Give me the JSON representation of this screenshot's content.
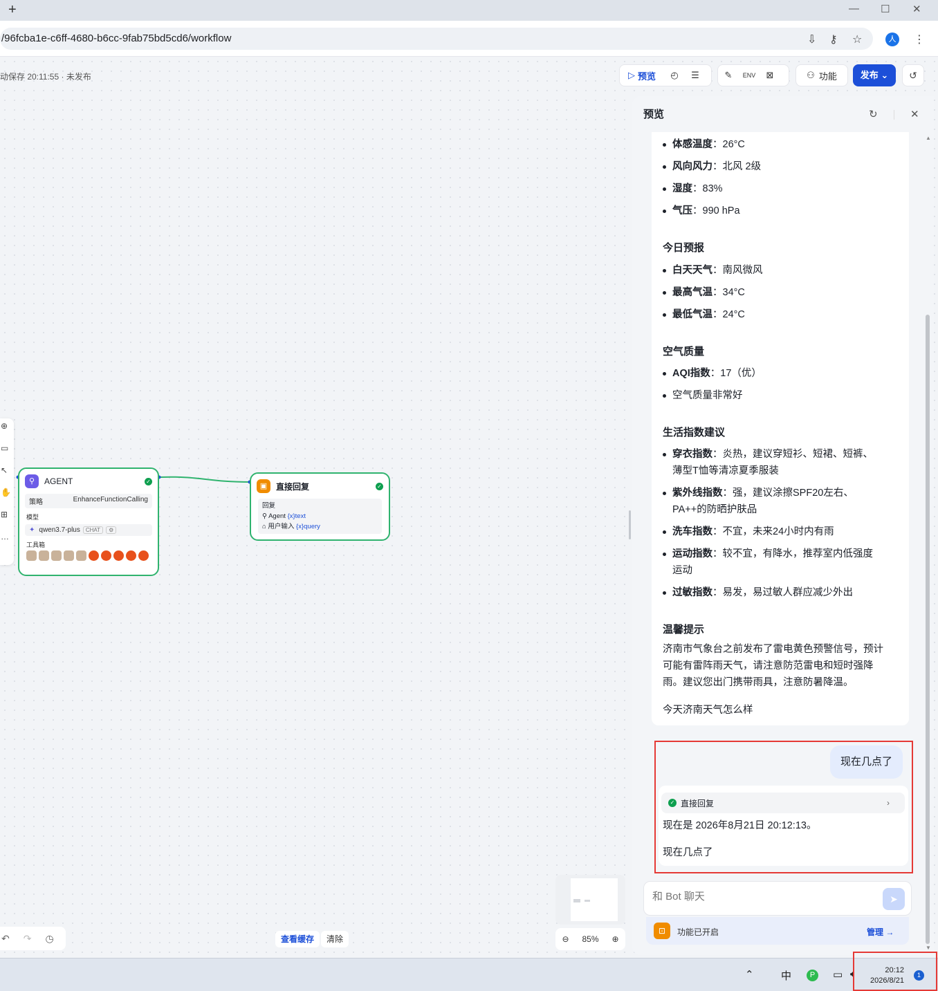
{
  "browser": {
    "url": "/96fcba1e-c6ff-4680-b6cc-9fab75bd5cd6/workflow",
    "avatar": "人"
  },
  "header": {
    "autosave": "动保存 20:11:55 · 未发布",
    "preview_label": "预览",
    "feature_label": "功能",
    "publish_label": "发布"
  },
  "nodes": {
    "agent": {
      "title": "AGENT",
      "strategy_label": "策略",
      "strategy_value": "EnhanceFunctionCalling",
      "model_label": "模型",
      "model_value": "qwen3.7-plus",
      "model_chip": "CHAT",
      "toolbox_label": "工具箱"
    },
    "reply": {
      "title": "直接回复",
      "section_label": "回复",
      "line1_source": "Agent",
      "line1_var": "{x}text",
      "line2_source": "用户输入",
      "line2_var": "{x}query"
    }
  },
  "canvas_controls": {
    "view_cache": "查看缓存",
    "clear": "清除",
    "zoom": "85%"
  },
  "preview": {
    "title": "预览",
    "weather_items": [
      {
        "label": "体感温度",
        "value": "：26°C"
      },
      {
        "label": "风向风力",
        "value": "：北风 2级"
      },
      {
        "label": "湿度",
        "value": "：83%"
      },
      {
        "label": "气压",
        "value": "：990 hPa"
      }
    ],
    "forecast_title": "今日预报",
    "forecast_items": [
      {
        "label": "白天天气",
        "value": "：南风微风"
      },
      {
        "label": "最高气温",
        "value": "：34°C"
      },
      {
        "label": "最低气温",
        "value": "：24°C"
      }
    ],
    "air_title": "空气质量",
    "air_items": [
      {
        "label": "AQI指数",
        "value": "：17（优）"
      },
      {
        "label": "",
        "value": "空气质量非常好"
      }
    ],
    "life_title": "生活指数建议",
    "life_items": [
      {
        "label": "穿衣指数",
        "value": "：炎热，建议穿短衫、短裙、短裤、",
        "value2": "薄型T恤等清凉夏季服装"
      },
      {
        "label": "紫外线指数",
        "value": "：强，建议涂擦SPF20左右、",
        "value2": "PA++的防晒护肤品"
      },
      {
        "label": "洗车指数",
        "value": "：不宜，未来24小时内有雨",
        "value2": ""
      },
      {
        "label": "运动指数",
        "value": "：较不宜，有降水，推荐室内低强度",
        "value2": "运动"
      },
      {
        "label": "过敏指数",
        "value": "：易发，易过敏人群应减少外出",
        "value2": ""
      }
    ],
    "tip_title": "温馨提示",
    "tip_lines": [
      "济南市气象台之前发布了雷电黄色预警信号，预计",
      "可能有雷阵雨天气，请注意防范雷电和短时强降",
      "雨。建议您出门携带雨具，注意防暑降温。"
    ],
    "prev_query": "今天济南天气怎么样",
    "user_message": "现在几点了",
    "reply_step": "直接回复",
    "reply_text": "现在是 2026年8月21日 20:12:13。",
    "reply_query": "现在几点了",
    "input_placeholder": "和 Bot 聊天",
    "feature_enabled": "功能已开启",
    "manage": "管理 →"
  },
  "taskbar": {
    "ime": "中",
    "time": "20:12",
    "date": "2026/8/21",
    "notif": "1"
  },
  "colors": {
    "primary": "#1c4fd8",
    "success": "#2fb36e",
    "highlight": "#e53935"
  }
}
